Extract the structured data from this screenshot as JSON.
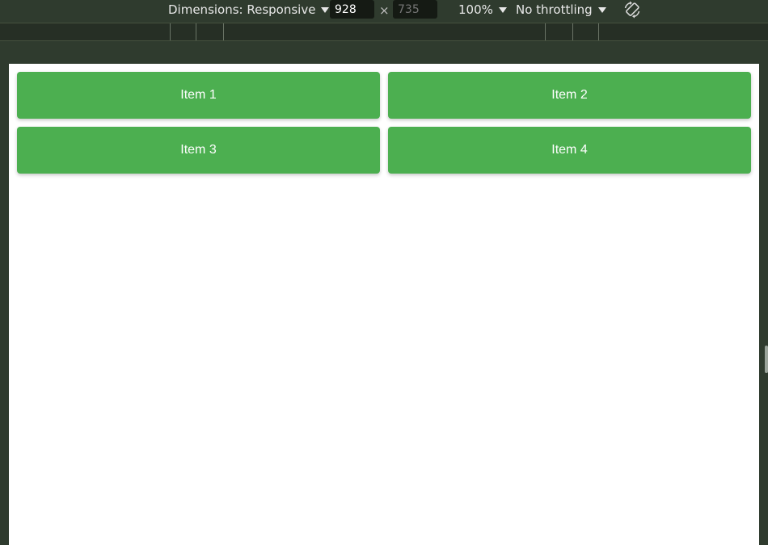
{
  "toolbar": {
    "dimensions_label": "Dimensions: Responsive",
    "width_value": "928",
    "height_placeholder": "735",
    "times_sign": "×",
    "zoom_label": "100%",
    "throttling_label": "No throttling",
    "rotate_icon": "rotate-icon"
  },
  "page": {
    "items": [
      {
        "label": "Item 1"
      },
      {
        "label": "Item 2"
      },
      {
        "label": "Item 3"
      },
      {
        "label": "Item 4"
      }
    ]
  },
  "colors": {
    "item_background": "#4caf50",
    "chrome_background": "#2f3b2e",
    "viewport_background": "#ffffff"
  }
}
